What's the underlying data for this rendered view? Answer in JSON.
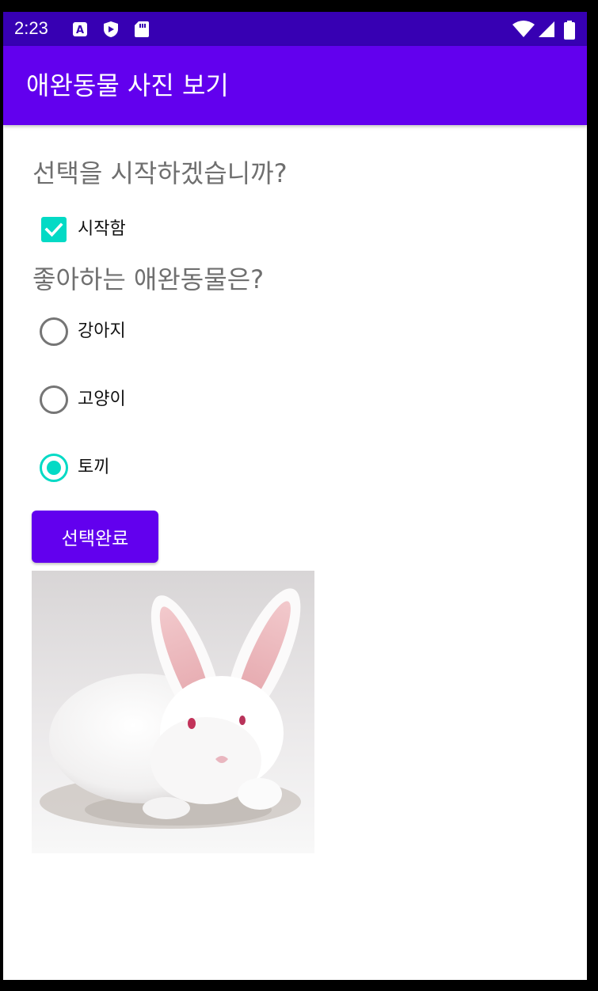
{
  "status_bar": {
    "time": "2:23",
    "left_icons": [
      "a-notification-icon",
      "shield-play-icon",
      "sd-card-icon"
    ],
    "right_icons": [
      "wifi-icon",
      "signal-icon",
      "battery-icon"
    ]
  },
  "app_bar": {
    "title": "애완동물 사진 보기"
  },
  "colors": {
    "status_bar": "#3700b3",
    "primary": "#6200ee",
    "accent": "#03dac5"
  },
  "start_section": {
    "question": "선택을 시작하겠습니까?",
    "checkbox_label": "시작함",
    "checked": true
  },
  "pet_section": {
    "question": "좋아하는 애완동물은?",
    "options": [
      {
        "label": "강아지",
        "selected": false
      },
      {
        "label": "고양이",
        "selected": false
      },
      {
        "label": "토끼",
        "selected": true
      }
    ]
  },
  "done_button": {
    "label": "선택완료"
  },
  "image": {
    "subject": "rabbit"
  }
}
